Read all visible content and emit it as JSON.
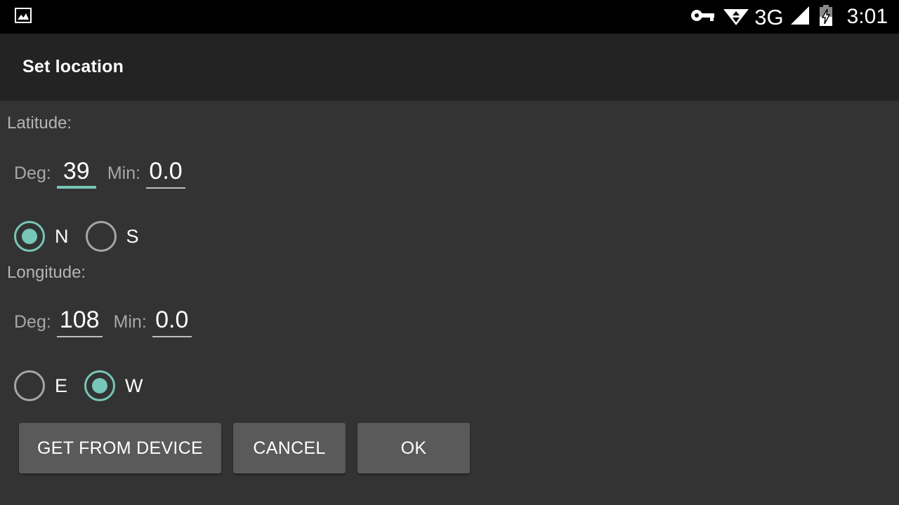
{
  "statusbar": {
    "left_icons": [
      {
        "name": "photo-image-icon",
        "glyph": "image"
      }
    ],
    "right_icons": [
      {
        "name": "vpn-key-icon",
        "glyph": "key"
      },
      {
        "name": "wifi-icon",
        "glyph": "wifi-updown"
      },
      {
        "name": "signal-cellular-icon",
        "glyph": "signal-bars"
      },
      {
        "name": "battery-charging-icon",
        "glyph": "battery-bolt"
      }
    ],
    "network_type": "3G",
    "time": "3:01",
    "background": "#000000",
    "foreground": "#ffffff"
  },
  "appbar": {
    "title": "Set location",
    "background": "#232323"
  },
  "theme": {
    "body_background": "#333333",
    "accent": "#76c7b7",
    "label_color": "#b4b4b4",
    "value_color": "#ffffff",
    "underline_color": "#bdbdbd",
    "button_background": "#5a5a5a"
  },
  "form": {
    "latitude": {
      "section_label": "Latitude:",
      "deg_label": "Deg:",
      "deg_value": "39",
      "deg_focused": true,
      "min_label": "Min:",
      "min_value": "0.0",
      "min_focused": false,
      "hemispheres": [
        {
          "label": "N",
          "selected": true
        },
        {
          "label": "S",
          "selected": false
        }
      ]
    },
    "longitude": {
      "section_label": "Longitude:",
      "deg_label": "Deg:",
      "deg_value": "108",
      "deg_focused": false,
      "min_label": "Min:",
      "min_value": "0.0",
      "min_focused": false,
      "hemispheres": [
        {
          "label": "E",
          "selected": false
        },
        {
          "label": "W",
          "selected": true
        }
      ]
    }
  },
  "buttons": {
    "get_from_device": "GET FROM DEVICE",
    "cancel": "CANCEL",
    "ok": "OK"
  }
}
